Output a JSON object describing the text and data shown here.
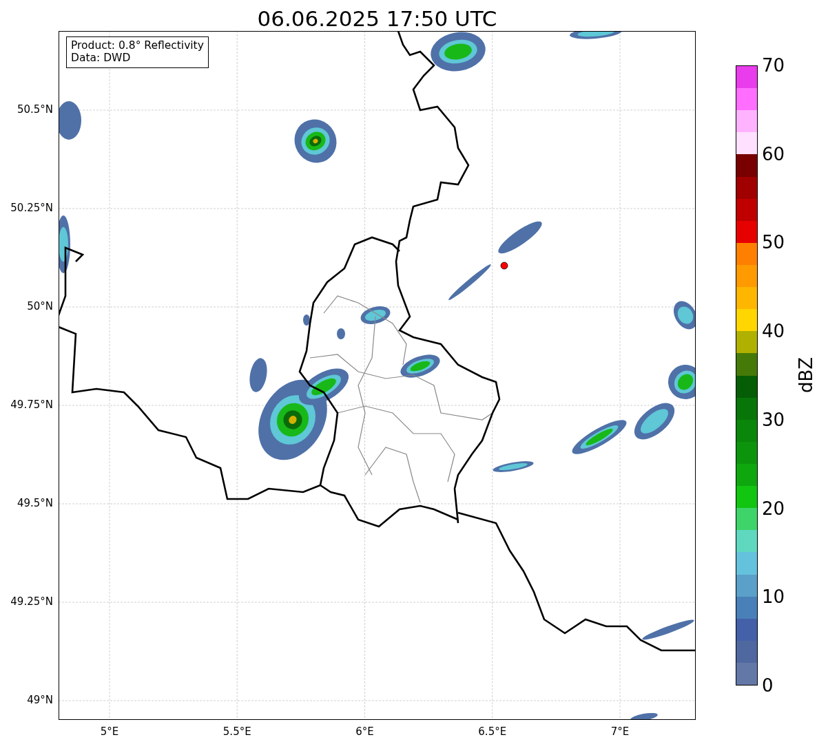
{
  "title": "06.06.2025 17:50 UTC",
  "map": {
    "info_box": [
      "Product: 0.8° Reflectivity",
      "Data: DWD"
    ],
    "y_ticks": [
      "50.5°N",
      "50.25°N",
      "50°N",
      "49.75°N",
      "49.5°N",
      "49.25°N",
      "49°N"
    ],
    "x_ticks": [
      "5°E",
      "5.5°E",
      "6°E",
      "6.5°E",
      "7°E"
    ]
  },
  "colorbar": {
    "label": "dBZ",
    "ticks": [
      "70",
      "60",
      "50",
      "40",
      "30",
      "20",
      "10",
      "0"
    ],
    "levels": [
      {
        "color": "#e93cec"
      },
      {
        "color": "#ff6eff"
      },
      {
        "color": "#ffb3ff"
      },
      {
        "color": "#ffe0ff"
      },
      {
        "color": "#780000"
      },
      {
        "color": "#a00000"
      },
      {
        "color": "#c00000"
      },
      {
        "color": "#e60000"
      },
      {
        "color": "#ff7f00"
      },
      {
        "color": "#ff9a00"
      },
      {
        "color": "#ffb600"
      },
      {
        "color": "#ffd600"
      },
      {
        "color": "#b0b000"
      },
      {
        "color": "#467a08"
      },
      {
        "color": "#055e05"
      },
      {
        "color": "#087508"
      },
      {
        "color": "#0a860a"
      },
      {
        "color": "#0c950c"
      },
      {
        "color": "#0ea70e"
      },
      {
        "color": "#11c511"
      },
      {
        "color": "#3ed46a"
      },
      {
        "color": "#60d8c0"
      },
      {
        "color": "#65c2dc"
      },
      {
        "color": "#5aa0c8"
      },
      {
        "color": "#4a80b8"
      },
      {
        "color": "#4460a8"
      },
      {
        "color": "#5068a0"
      },
      {
        "color": "#6478a8"
      }
    ]
  }
}
